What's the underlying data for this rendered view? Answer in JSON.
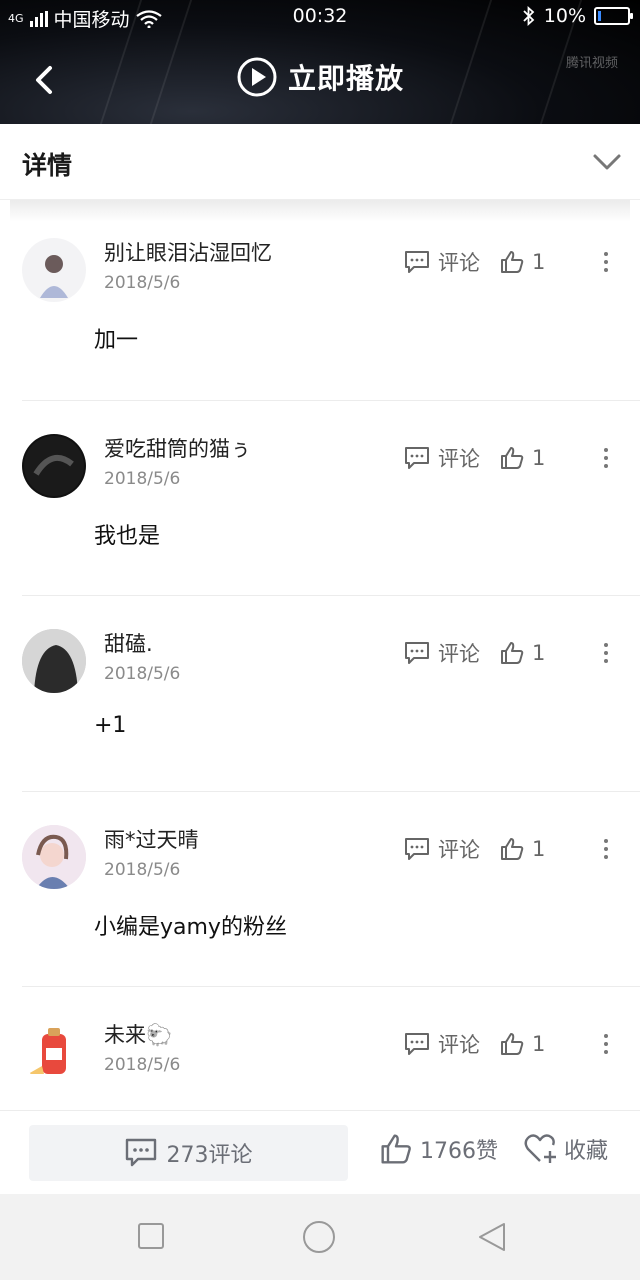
{
  "status_bar": {
    "network": "4G",
    "carrier": "中国移动",
    "time": "00:32",
    "battery": "10%",
    "battery_level": 0.1
  },
  "header": {
    "title": "立即播放",
    "watermark": "腾讯视频"
  },
  "details": {
    "title": "详情"
  },
  "comments": [
    {
      "username": "别让眼泪沾湿回忆",
      "date": "2018/5/6",
      "text": "加一",
      "comment_label": "评论",
      "likes": "1"
    },
    {
      "username": "爱吃甜筒的猫ぅ",
      "date": "2018/5/6",
      "text": "我也是",
      "comment_label": "评论",
      "likes": "1"
    },
    {
      "username": "甜磕.",
      "date": "2018/5/6",
      "text": "+1",
      "comment_label": "评论",
      "likes": "1"
    },
    {
      "username": "雨*过天晴",
      "date": "2018/5/6",
      "text": "小编是yamy的粉丝",
      "comment_label": "评论",
      "likes": "1"
    },
    {
      "username": "未来🐑",
      "date": "2018/5/6",
      "text": "",
      "comment_label": "评论",
      "likes": "1"
    }
  ],
  "bottom_bar": {
    "comments": "273评论",
    "likes": "1766赞",
    "favorite": "收藏"
  },
  "colors": {
    "accent_blue": "#3b8cff",
    "header_bg": "#000000",
    "icon_gray": "#666666"
  }
}
